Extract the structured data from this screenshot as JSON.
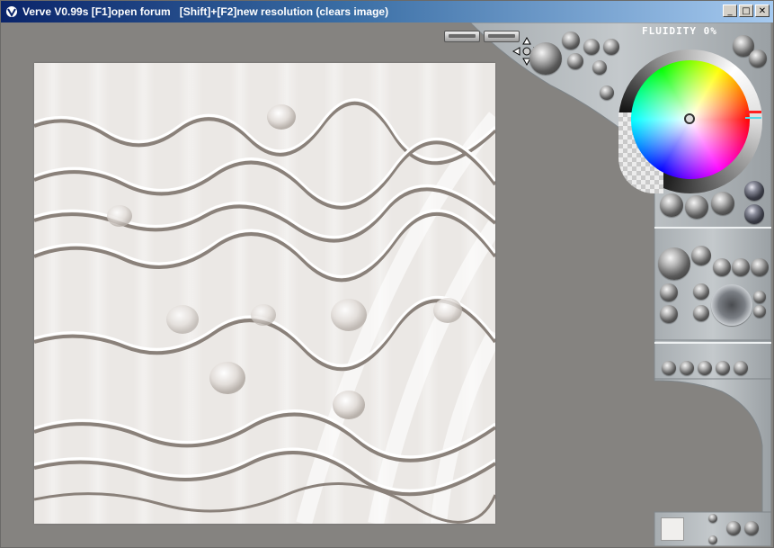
{
  "window": {
    "title": "Verve V0.99s [F1]open forum   [Shift]+[F2]new resolution (clears image)",
    "controls": {
      "minimize": "_",
      "maximize": "□",
      "close": "✕"
    }
  },
  "panel": {
    "fluidity_label": "FLUIDITY 0%"
  },
  "colors": {
    "workspace_bg": "#858380",
    "panel_metal": "#9aa0a4",
    "panel_light": "#c5cacd",
    "canvas_paper": "#ece9e6",
    "current_color": "#f0efed"
  },
  "icons": {
    "app": "verve-app-icon",
    "move": "four-way-arrow-icon"
  }
}
